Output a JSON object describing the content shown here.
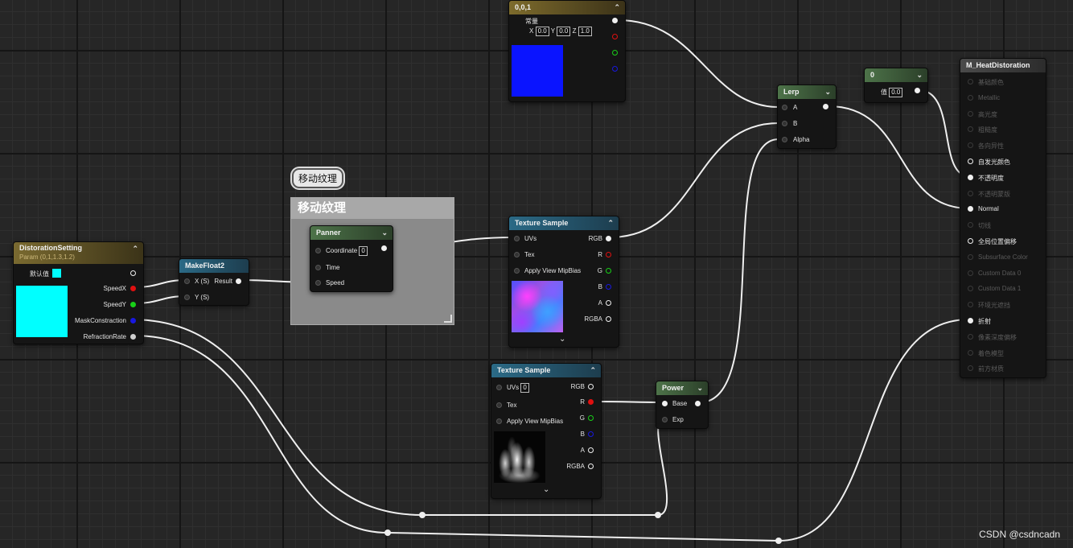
{
  "constant_node": {
    "title": "0,0,1",
    "label": "常量",
    "x_label": "X",
    "x_value": "0.0",
    "y_label": "Y",
    "y_value": "0.0",
    "z_label": "Z",
    "z_value": "1.0",
    "preview_color": "#0a14ff"
  },
  "scalar_node": {
    "title": "0",
    "label": "值",
    "value": "0.0"
  },
  "lerp_node": {
    "title": "Lerp",
    "inputs": [
      "A",
      "B",
      "Alpha"
    ]
  },
  "result_node": {
    "title": "M_HeatDistoration",
    "pins": [
      {
        "label": "基础颜色",
        "active": false
      },
      {
        "label": "Metallic",
        "active": false
      },
      {
        "label": "高光度",
        "active": false
      },
      {
        "label": "粗糙度",
        "active": false
      },
      {
        "label": "各向异性",
        "active": false
      },
      {
        "label": "自发光颜色",
        "active": true
      },
      {
        "label": "不透明度",
        "active": true
      },
      {
        "label": "不透明蒙版",
        "active": false
      },
      {
        "label": "Normal",
        "active": true
      },
      {
        "label": "切线",
        "active": false
      },
      {
        "label": "全局位置偏移",
        "active": true
      },
      {
        "label": "Subsurface Color",
        "active": false
      },
      {
        "label": "Custom Data 0",
        "active": false
      },
      {
        "label": "Custom Data 1",
        "active": false
      },
      {
        "label": "环境光遮挡",
        "active": false
      },
      {
        "label": "折射",
        "active": true
      },
      {
        "label": "像素深度偏移",
        "active": false
      },
      {
        "label": "着色模型",
        "active": false
      },
      {
        "label": "前方材质",
        "active": false
      }
    ]
  },
  "comment": {
    "bubble": "移动纹理",
    "title": "移动纹理"
  },
  "panner_node": {
    "title": "Panner",
    "coordinate_label": "Coordinate",
    "coordinate_value": "0",
    "time_label": "Time",
    "speed_label": "Speed"
  },
  "param_node": {
    "title": "DistorationSetting",
    "subtitle": "Param (0,1,1.3,1.2)",
    "default_label": "默认值",
    "default_color": "#00ffff",
    "outputs": [
      "SpeedX",
      "SpeedY",
      "MaskConstraction",
      "RefractionRate"
    ]
  },
  "makefloat_node": {
    "title": "MakeFloat2",
    "x_label": "X (S)",
    "y_label": "Y (S)",
    "result_label": "Result"
  },
  "texture_sample_top": {
    "title": "Texture Sample",
    "inputs": [
      "UVs",
      "Tex",
      "Apply View MipBias"
    ],
    "outputs": [
      "RGB",
      "R",
      "G",
      "B",
      "A",
      "RGBA"
    ]
  },
  "texture_sample_bottom": {
    "title": "Texture Sample",
    "uvs_label": "UVs",
    "uvs_value": "0",
    "inputs": [
      "Tex",
      "Apply View MipBias"
    ],
    "outputs": [
      "RGB",
      "R",
      "G",
      "B",
      "A",
      "RGBA"
    ]
  },
  "power_node": {
    "title": "Power",
    "inputs": [
      "Base",
      "Exp"
    ]
  },
  "watermark": "CSDN @csdncadn",
  "colors": {
    "param_header": "#7a6a30",
    "texture_header": "#2b6a86",
    "math_header": "#4d7349",
    "wire": "#f0f0f0"
  }
}
